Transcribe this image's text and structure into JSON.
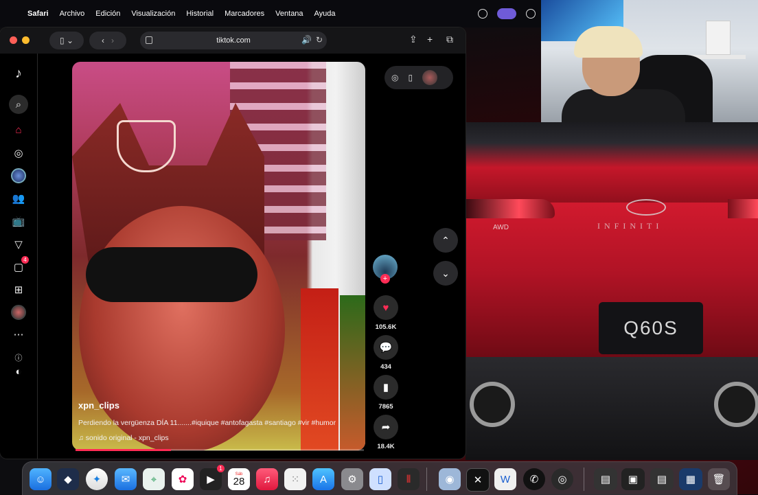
{
  "menubar": {
    "app": "Safari",
    "items": [
      "Archivo",
      "Edición",
      "Visualización",
      "Historial",
      "Marcadores",
      "Ventana",
      "Ayuda"
    ]
  },
  "browser": {
    "url": "tiktok.com"
  },
  "sidebar": {
    "messages_badge": "4"
  },
  "video": {
    "username": "xpn_clips",
    "description": "Perdiendo la vergüenza DÍA 11.......#iquique #antofagasta #santiago #vir #humor",
    "music": "sonido original - xpn_clips",
    "progress": 0.33
  },
  "actions": {
    "likes": "105.6K",
    "comments": "434",
    "saves": "7865",
    "shares": "18.4K"
  },
  "car": {
    "plate": "Q60S",
    "brand": "INFINITI",
    "awd": "AWD"
  },
  "dock": {
    "calendar_day": "28",
    "calendar_month": "Sáb",
    "badge": "1"
  }
}
